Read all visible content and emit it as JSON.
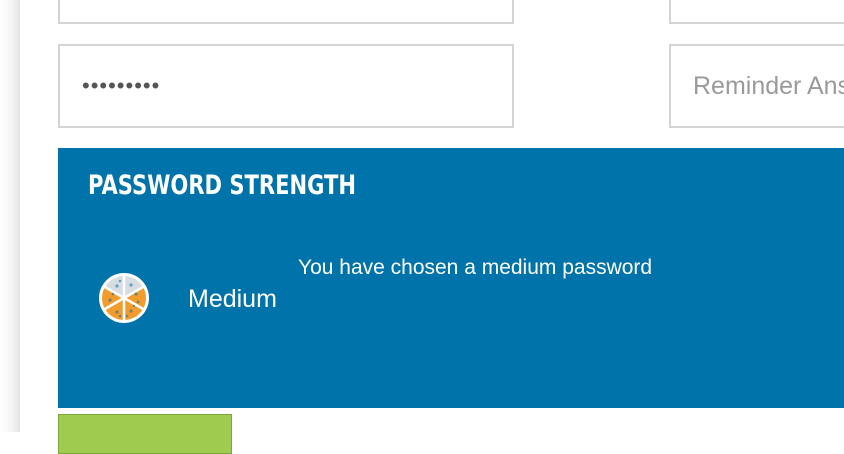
{
  "form": {
    "password_value": "•••••••••",
    "reminder_placeholder": "Reminder Answer"
  },
  "strength": {
    "heading": "PASSWORD STRENGTH",
    "level": "Medium",
    "message": "You have chosen a medium password",
    "icon": "pizza-icon",
    "colors": {
      "panel": "#0073aa",
      "pizza_fill": "#f39c2e",
      "pizza_empty": "#d7dde3",
      "submit_button": "#9fcb4e"
    }
  }
}
